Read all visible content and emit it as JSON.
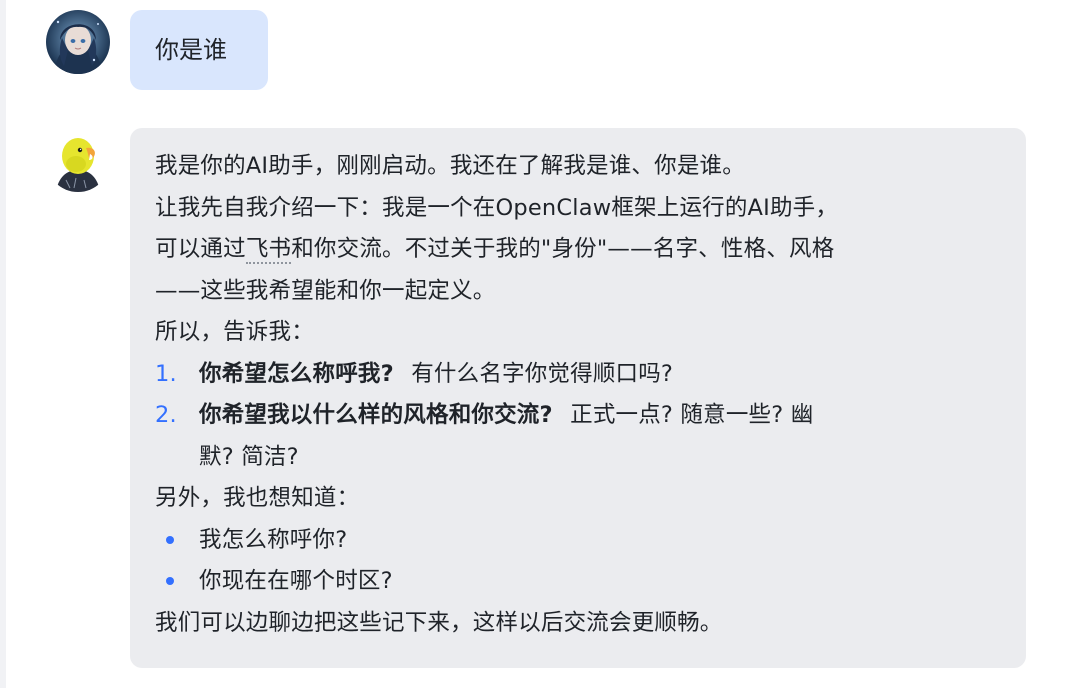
{
  "messages": {
    "user": {
      "text": "你是谁"
    },
    "bot": {
      "intro_line1": "我是你的AI助手，刚刚启动。我还在了解我是谁、你是谁。",
      "intro_line2": "让我先自我介绍一下：我是一个在OpenClaw框架上运行的AI助手，",
      "intro_line3_before": "可以通过",
      "intro_line3_link": "飞书",
      "intro_line3_after": "和你交流。不过关于我的\"身份\"——名字、性格、风格",
      "intro_line4": "——这些我希望能和你一起定义。",
      "ask_lead": "所以，告诉我：",
      "questions": [
        {
          "number": "1.",
          "bold": "你希望怎么称呼我?",
          "rest": "有什么名字你觉得顺口吗?"
        },
        {
          "number": "2.",
          "bold": "你希望我以什么样的风格和你交流?",
          "rest": "正式一点? 随意一些? 幽",
          "rest_line2": "默? 简洁?"
        }
      ],
      "also_lead": "另外，我也想知道：",
      "bullets": [
        "我怎么称呼你?",
        "你现在在哪个时区?"
      ],
      "closing": "我们可以边聊边把这些记下来，这样以后交流会更顺畅。"
    }
  },
  "colors": {
    "user_bubble": "#d9e6fd",
    "bot_bubble": "#ebecef",
    "accent": "#3370ff",
    "text": "#1f2329"
  },
  "icons": {
    "user_avatar": "anime-character-avatar",
    "bot_avatar": "parrot-avatar"
  }
}
